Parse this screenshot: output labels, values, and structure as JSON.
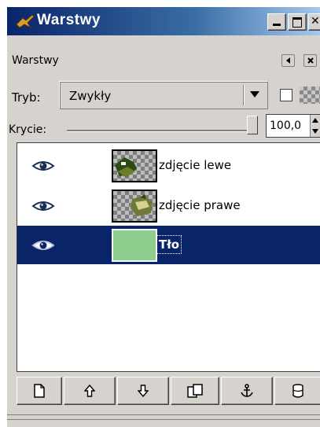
{
  "window": {
    "title": "Warstwy"
  },
  "panel": {
    "title": "Warstwy"
  },
  "mode": {
    "label": "Tryb:",
    "value": "Zwykły"
  },
  "opacity": {
    "label": "Krycie:",
    "value": "100,0",
    "percent": 100
  },
  "layers": [
    {
      "name": "zdjęcie lewe",
      "visible": true,
      "selected": false
    },
    {
      "name": "zdjęcie prawe",
      "visible": true,
      "selected": false
    },
    {
      "name": "Tło",
      "visible": true,
      "selected": true
    }
  ],
  "toolbar_icons": [
    "new-layer-icon",
    "raise-layer-icon",
    "lower-layer-icon",
    "duplicate-layer-icon",
    "anchor-layer-icon",
    "delete-layer-icon"
  ],
  "colors": {
    "selection": "#0a246a",
    "background_layer": "#8ccd8c",
    "titlebar": "#0a246a"
  }
}
